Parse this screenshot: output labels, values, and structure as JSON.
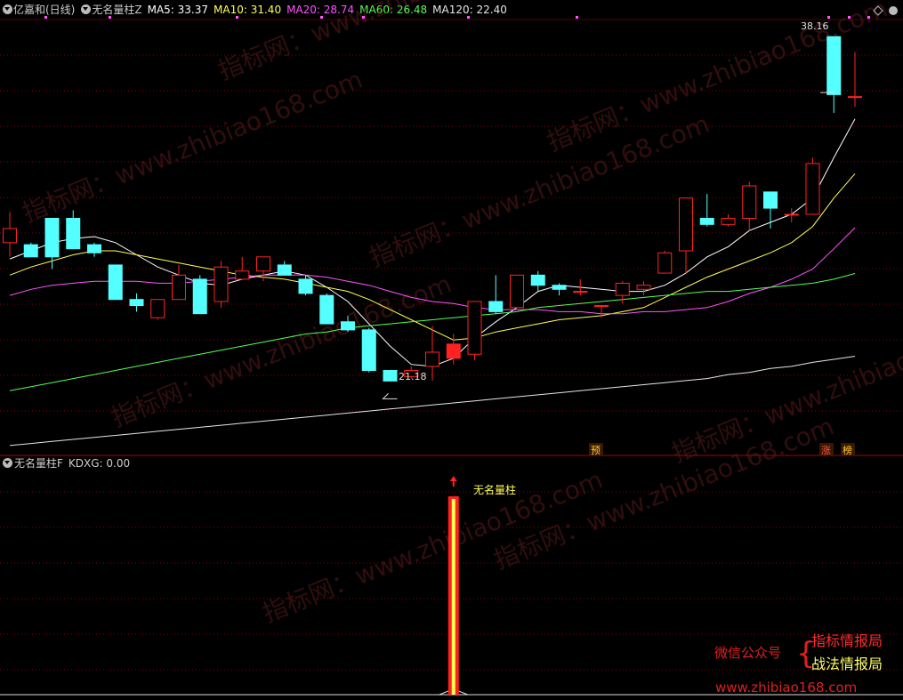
{
  "top_header": {
    "stock": "亿嘉和(日线)",
    "indicator": "无名量柱Z",
    "ma5": "MA5: 33.37",
    "ma10": "MA10: 31.40",
    "ma20": "MA20: 28.74",
    "ma60": "MA60: 26.48",
    "ma120": "MA120: 22.40"
  },
  "bottom_header": {
    "indicator": "无名量柱F",
    "kdxg": "KDXG: 0.00"
  },
  "labels": {
    "high_price": "38.16",
    "low_price": "21.18",
    "signal": "无名量柱",
    "yu": "预",
    "zhang": "涨",
    "bang": "榜"
  },
  "promo": {
    "wechat": "微信公众号",
    "line1": "指标情报局",
    "line2": "战法情报局",
    "url": "www.zhibiao168.com"
  },
  "watermark": {
    "text": "指标网：www.zhibiao168.com"
  },
  "colors": {
    "up": "#ff2222",
    "down": "#54ffff",
    "ma5": "#ffffff",
    "ma10": "#ffff54",
    "ma20": "#ff54ff",
    "ma60": "#54ff54",
    "ma120": "#e6e6e6",
    "grid": "#8b0000"
  },
  "chart_data": {
    "type": "candlestick",
    "price_axis_range": [
      17.6,
      39.0
    ],
    "candles": [
      {
        "o": 28.0,
        "h": 29.5,
        "c": 28.7,
        "l": 27.3
      },
      {
        "o": 27.9,
        "h": 28.0,
        "c": 27.3,
        "l": 27.3
      },
      {
        "o": 29.2,
        "h": 29.2,
        "c": 27.3,
        "l": 26.7
      },
      {
        "o": 29.2,
        "h": 29.6,
        "c": 27.7,
        "l": 27.7
      },
      {
        "o": 27.9,
        "h": 28.0,
        "c": 27.5,
        "l": 27.3
      },
      {
        "o": 26.9,
        "h": 26.9,
        "c": 25.2,
        "l": 25.2
      },
      {
        "o": 25.2,
        "h": 25.5,
        "c": 24.9,
        "l": 24.6
      },
      {
        "o": 24.3,
        "h": 25.2,
        "c": 25.2,
        "l": 24.2
      },
      {
        "o": 25.2,
        "h": 26.9,
        "c": 26.4,
        "l": 25.2
      },
      {
        "o": 26.2,
        "h": 26.4,
        "c": 24.5,
        "l": 24.5
      },
      {
        "o": 25.1,
        "h": 27.1,
        "c": 26.8,
        "l": 24.8
      },
      {
        "o": 26.2,
        "h": 27.3,
        "c": 26.6,
        "l": 26.2
      },
      {
        "o": 26.6,
        "h": 27.3,
        "c": 27.3,
        "l": 26.1
      },
      {
        "o": 26.9,
        "h": 27.1,
        "c": 26.4,
        "l": 26.4
      },
      {
        "o": 26.2,
        "h": 26.4,
        "c": 25.5,
        "l": 25.4
      },
      {
        "o": 25.4,
        "h": 25.5,
        "c": 24.0,
        "l": 24.0
      },
      {
        "o": 24.1,
        "h": 24.4,
        "c": 23.7,
        "l": 23.6
      },
      {
        "o": 23.7,
        "h": 23.8,
        "c": 21.7,
        "l": 21.6
      },
      {
        "o": 21.7,
        "h": 21.7,
        "c": 21.18,
        "l": 21.18
      },
      {
        "o": 21.4,
        "h": 21.9,
        "c": 21.7,
        "l": 21.3
      },
      {
        "o": 21.9,
        "h": 23.9,
        "c": 22.6,
        "l": 21.2
      },
      {
        "o": 22.3,
        "h": 23.5,
        "c": 23.0,
        "l": 22.0
      },
      {
        "o": 22.5,
        "h": 25.1,
        "c": 25.1,
        "l": 22.2
      },
      {
        "o": 25.1,
        "h": 26.4,
        "c": 24.6,
        "l": 24.5
      },
      {
        "o": 24.8,
        "h": 26.4,
        "c": 26.4,
        "l": 24.8
      },
      {
        "o": 26.4,
        "h": 26.6,
        "c": 25.9,
        "l": 25.6
      },
      {
        "o": 25.9,
        "h": 26.0,
        "c": 25.7,
        "l": 25.4
      },
      {
        "o": 25.6,
        "h": 26.2,
        "c": 25.6,
        "l": 25.4
      },
      {
        "o": 24.9,
        "h": 24.9,
        "c": 24.9,
        "l": 24.3
      },
      {
        "o": 25.4,
        "h": 26.1,
        "c": 26.0,
        "l": 25.0
      },
      {
        "o": 25.7,
        "h": 26.1,
        "c": 25.9,
        "l": 25.4
      },
      {
        "o": 26.5,
        "h": 27.6,
        "c": 27.5,
        "l": 26.5
      },
      {
        "o": 27.6,
        "h": 30.2,
        "c": 30.2,
        "l": 26.5
      },
      {
        "o": 29.2,
        "h": 30.4,
        "c": 28.9,
        "l": 28.8
      },
      {
        "o": 28.9,
        "h": 29.4,
        "c": 29.2,
        "l": 28.8
      },
      {
        "o": 29.2,
        "h": 31.0,
        "c": 30.8,
        "l": 28.6
      },
      {
        "o": 30.5,
        "h": 30.5,
        "c": 29.7,
        "l": 28.7
      },
      {
        "o": 29.4,
        "h": 29.7,
        "c": 29.4,
        "l": 29.0
      },
      {
        "o": 29.4,
        "h": 32.2,
        "c": 31.9,
        "l": 29.4
      },
      {
        "o": 38.16,
        "h": 38.16,
        "c": 35.3,
        "l": 34.4
      },
      {
        "o": 35.2,
        "h": 37.4,
        "c": 35.2,
        "l": 34.7
      }
    ],
    "ma_series": [
      {
        "name": "MA5",
        "values": [
          27.2,
          27.6,
          28.0,
          28.2,
          28.3,
          28.0,
          27.4,
          26.8,
          26.4,
          26.0,
          25.9,
          26.2,
          26.4,
          26.6,
          26.4,
          25.8,
          25.1,
          24.0,
          22.9,
          22.0,
          21.9,
          22.3,
          23.3,
          24.1,
          24.8,
          25.6,
          25.9,
          25.8,
          25.7,
          25.6,
          25.6,
          25.9,
          26.5,
          27.3,
          27.8,
          28.6,
          29.0,
          29.4,
          30.2,
          32.2,
          34.1
        ]
      },
      {
        "name": "MA10",
        "values": [
          26.4,
          26.8,
          27.1,
          27.4,
          27.6,
          27.6,
          27.4,
          27.2,
          27.0,
          26.8,
          26.6,
          26.4,
          26.3,
          26.2,
          26.0,
          25.8,
          25.6,
          25.2,
          24.7,
          24.2,
          23.7,
          23.2,
          23.3,
          23.6,
          23.8,
          24.0,
          24.2,
          24.3,
          24.4,
          24.6,
          24.8,
          25.3,
          25.8,
          26.3,
          26.7,
          27.1,
          27.5,
          28.0,
          28.8,
          30.2,
          31.4
        ]
      },
      {
        "name": "MA20",
        "values": [
          25.4,
          25.7,
          25.9,
          26.0,
          26.1,
          26.1,
          26.1,
          26.0,
          26.0,
          26.1,
          26.2,
          26.3,
          26.4,
          26.4,
          26.4,
          26.3,
          26.1,
          25.9,
          25.6,
          25.3,
          25.1,
          25.0,
          24.8,
          24.7,
          24.7,
          24.7,
          24.6,
          24.6,
          24.5,
          24.5,
          24.6,
          24.6,
          24.7,
          24.8,
          25.1,
          25.5,
          25.8,
          26.2,
          26.7,
          27.7,
          28.74
        ]
      },
      {
        "name": "MA60",
        "values": [
          20.7,
          20.9,
          21.1,
          21.3,
          21.5,
          21.7,
          21.9,
          22.1,
          22.3,
          22.5,
          22.7,
          22.9,
          23.1,
          23.3,
          23.5,
          23.6,
          23.8,
          23.9,
          24.0,
          24.1,
          24.2,
          24.3,
          24.4,
          24.5,
          24.6,
          24.8,
          24.9,
          25.0,
          25.1,
          25.2,
          25.3,
          25.4,
          25.5,
          25.6,
          25.6,
          25.7,
          25.8,
          25.9,
          26.0,
          26.2,
          26.48
        ]
      },
      {
        "name": "MA120",
        "values": [
          18.0,
          18.1,
          18.2,
          18.3,
          18.4,
          18.5,
          18.6,
          18.7,
          18.8,
          18.9,
          19.0,
          19.1,
          19.2,
          19.3,
          19.4,
          19.5,
          19.6,
          19.7,
          19.8,
          19.9,
          20.0,
          20.1,
          20.2,
          20.3,
          20.4,
          20.5,
          20.6,
          20.7,
          20.8,
          20.9,
          21.0,
          21.1,
          21.2,
          21.3,
          21.5,
          21.6,
          21.8,
          21.9,
          22.1,
          22.25,
          22.4
        ]
      }
    ],
    "signal_bar_index": 21,
    "signal_value": 1,
    "kdxg_current": 0.0
  }
}
